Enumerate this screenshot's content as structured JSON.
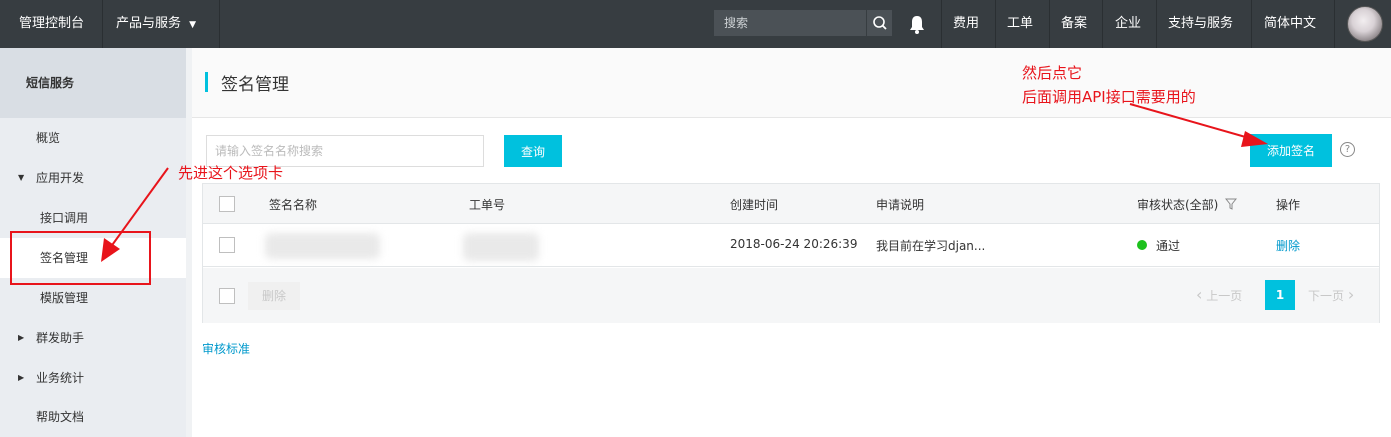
{
  "topbar": {
    "console": "管理控制台",
    "products": "产品与服务",
    "search_placeholder": "搜索",
    "menu": [
      "费用",
      "工单",
      "备案",
      "企业",
      "支持与服务",
      "简体中文"
    ]
  },
  "sidebar": {
    "title": "短信服务",
    "items": {
      "overview": "概览",
      "app_dev": "应用开发",
      "api_call": "接口调用",
      "sign_manage": "签名管理",
      "template_manage": "模版管理",
      "group_send": "群发助手",
      "stats": "业务统计",
      "help": "帮助文档"
    }
  },
  "page": {
    "title": "签名管理",
    "search_placeholder": "请输入签名名称搜索",
    "query_button": "查询",
    "add_button": "添加签名",
    "help_icon": "?"
  },
  "table": {
    "headers": {
      "name": "签名名称",
      "order": "工单号",
      "created": "创建时间",
      "desc": "申请说明",
      "status": "审核状态(全部)",
      "action": "操作"
    },
    "rows": [
      {
        "created": "2018-06-24 20:26:39",
        "desc": "我目前在学习djan...",
        "status": "通过",
        "action": "删除"
      }
    ],
    "footer": {
      "delete": "删除",
      "prev": "上一页",
      "page": "1",
      "next": "下一页"
    }
  },
  "bottom_link": "审核标准",
  "annotations": {
    "left_tip": "先进这个选项卡",
    "right_tip_line1": "然后点它",
    "right_tip_line2": "后面调用API接口需要用的"
  },
  "colors": {
    "accent": "#00c1de",
    "topbar": "#373d41",
    "annotation": "#e8141b",
    "status_ok": "#1dc11d"
  }
}
